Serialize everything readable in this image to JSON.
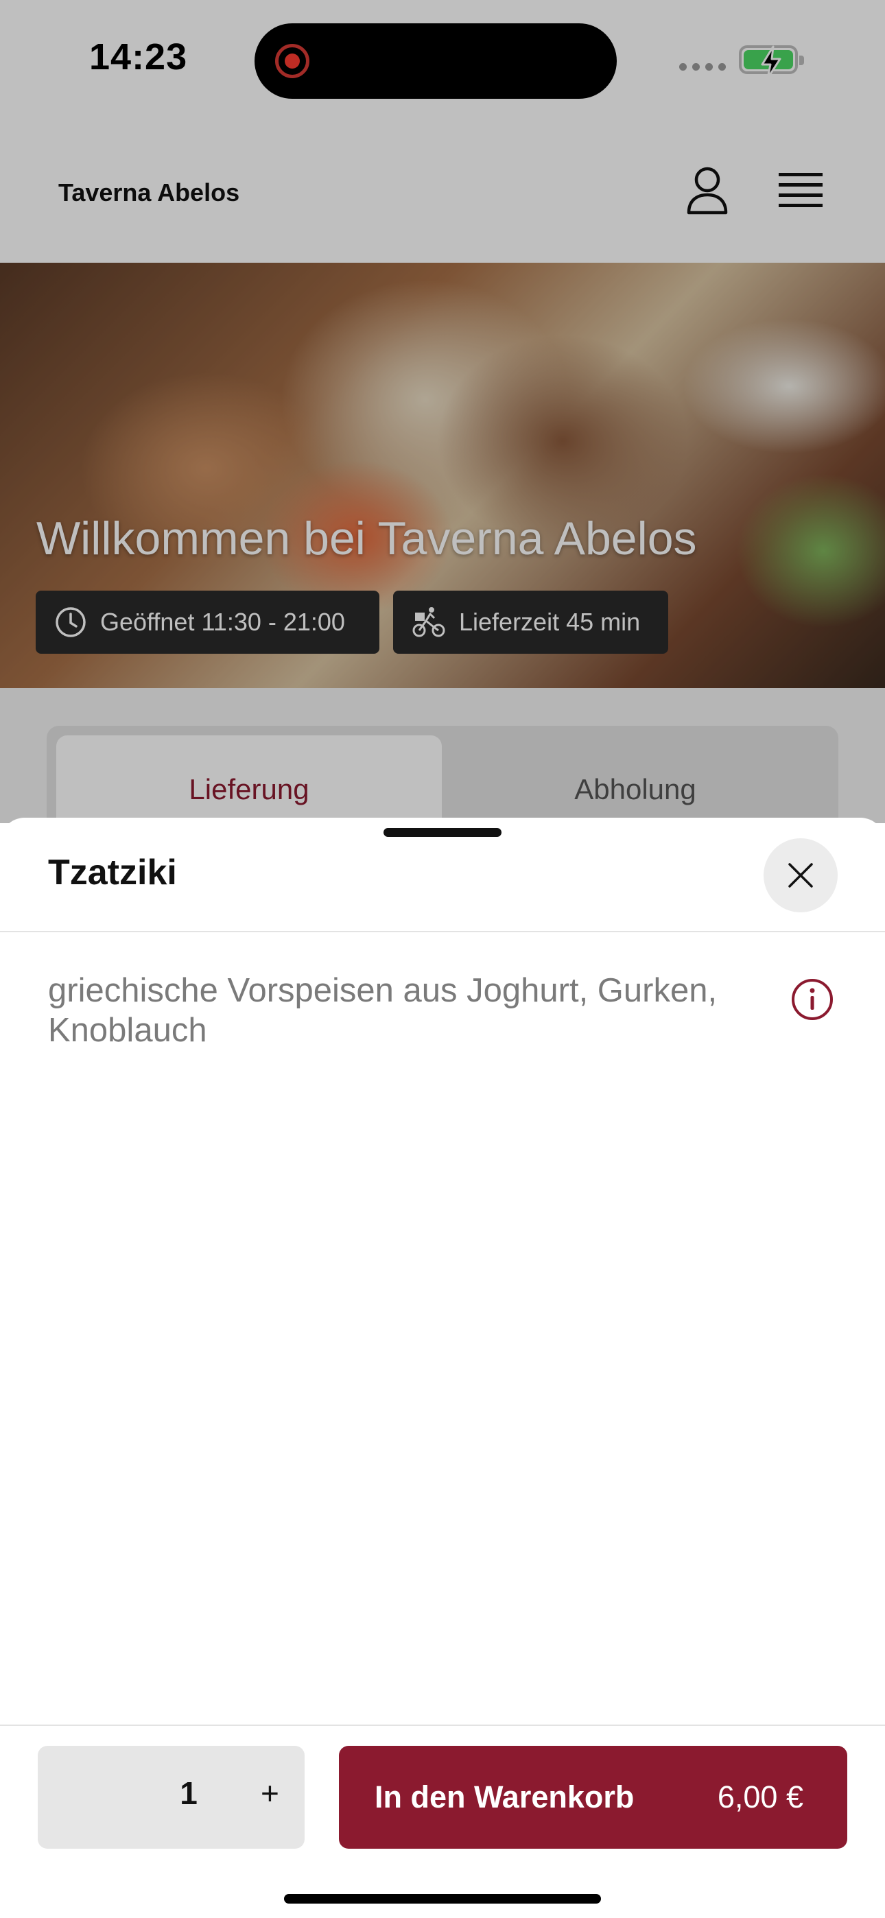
{
  "status_bar": {
    "time": "14:23"
  },
  "header": {
    "brand": "Taverna Abelos",
    "user_icon": "user-icon",
    "menu_icon": "hamburger-menu-icon"
  },
  "hero": {
    "title": "Willkommen bei Taverna Abelos",
    "opening_hours": "Geöffnet 11:30 - 21:00",
    "delivery_time": "Lieferzeit 45 min"
  },
  "tabs": [
    {
      "label": "Lieferung",
      "active": true
    },
    {
      "label": "Abholung",
      "active": false
    }
  ],
  "sheet": {
    "title": "Tzatziki",
    "description": "griechische Vorspeisen aus Joghurt, Gurken, Knoblauch"
  },
  "footer": {
    "quantity": "1",
    "plus": "+",
    "add_to_cart": "In den Warenkorb",
    "price": "6,00 €"
  },
  "colors": {
    "accent": "#8b1a2f",
    "battery": "#4cd964",
    "record": "#ff3b30"
  }
}
